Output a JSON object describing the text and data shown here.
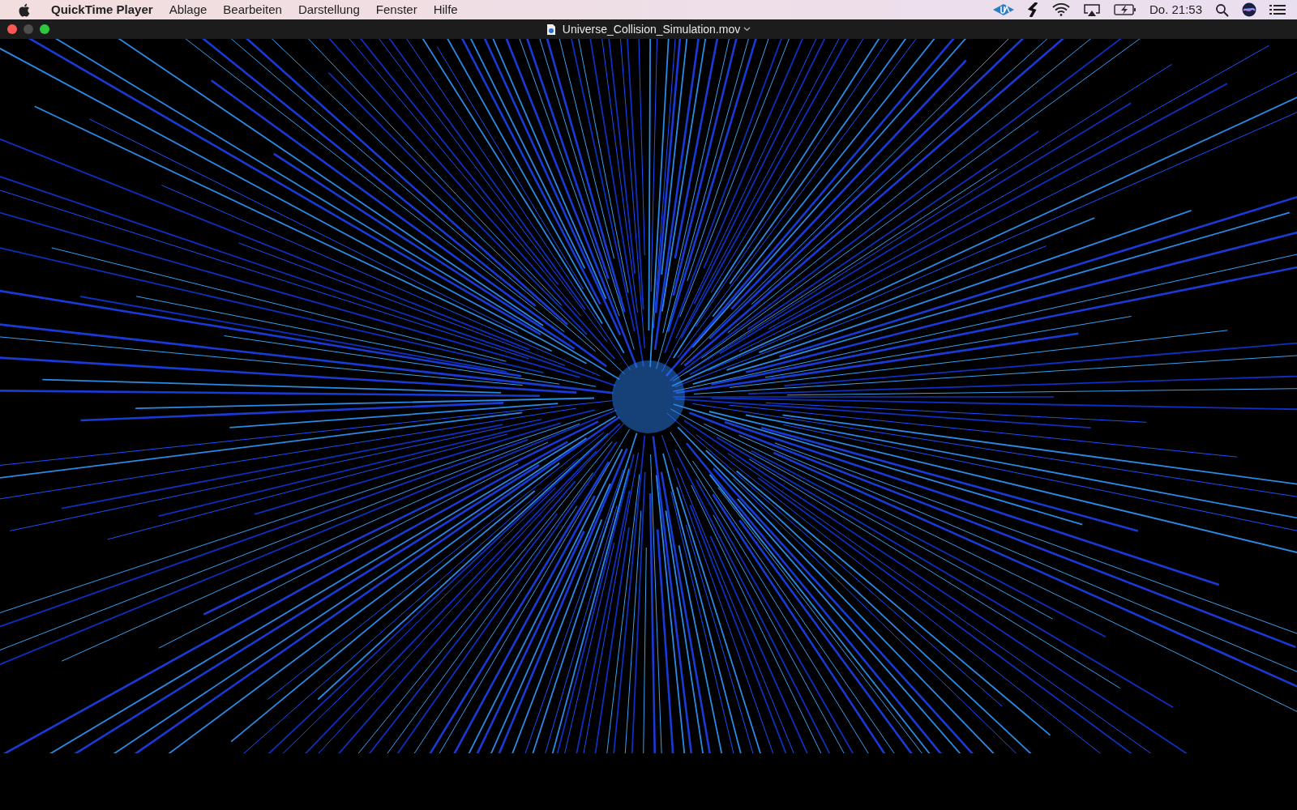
{
  "menu_bar": {
    "app_name": "QuickTime Player",
    "menus": [
      "Ablage",
      "Bearbeiten",
      "Darstellung",
      "Fenster",
      "Hilfe"
    ],
    "clock": "Do. 21:53"
  },
  "window": {
    "title": "Universe_Collision_Simulation.mov"
  }
}
